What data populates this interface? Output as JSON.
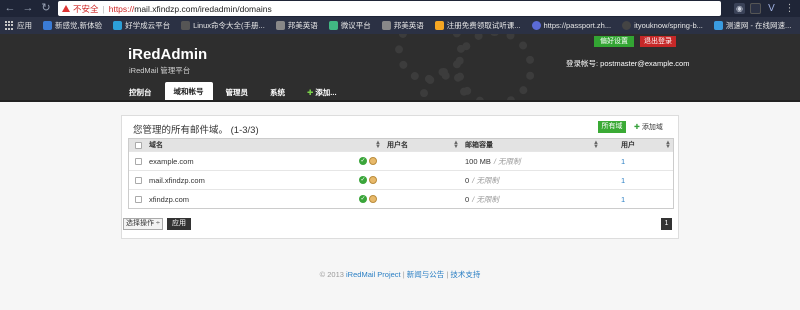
{
  "browser": {
    "insecure_label": "不安全",
    "url_https": "https://",
    "url_rest": "mail.xfindzp.com/iredadmin/domains",
    "bookmarks": [
      {
        "label": "应用",
        "color": "#c8c8c8"
      },
      {
        "label": "新感觉,新体验",
        "color": "#3a7bd5"
      },
      {
        "label": "好学成云平台",
        "color": "#2c9fd8"
      },
      {
        "label": "Linux命令大全(手册...",
        "color": "#555555"
      },
      {
        "label": "邦美英语",
        "color": "#888888"
      },
      {
        "label": "微议平台",
        "color": "#41b883"
      },
      {
        "label": "邦美英语",
        "color": "#888888"
      },
      {
        "label": "注册免费领取试听课...",
        "color": "#f5a623"
      },
      {
        "label": "https://passport.zh...",
        "color": "#5b6bd6"
      },
      {
        "label": "ityouknow/spring-b...",
        "color": "#444444"
      },
      {
        "label": "测速网 - 在线网速...",
        "color": "#3a9be0"
      }
    ]
  },
  "header": {
    "brand": "iRedAdmin",
    "subtitle": "iRedMail 管理平台",
    "pref_label": "偏好设置",
    "logout_label": "退出登录",
    "login_info": "登录帐号: postmaster@example.com",
    "nav": [
      {
        "label": "控制台",
        "active": false
      },
      {
        "label": "域和帐号",
        "active": true
      },
      {
        "label": "管理员",
        "active": false
      },
      {
        "label": "系统",
        "active": false
      },
      {
        "label": "添加...",
        "active": false
      }
    ]
  },
  "panel": {
    "title": "您管理的所有邮件域。 (1-3/3)",
    "all_domains_label": "所有域",
    "add_domain_label": "添加域",
    "columns": {
      "domain": "域名",
      "name": "用户名",
      "quota": "邮箱容量",
      "users": "用户"
    },
    "rows": [
      {
        "domain": "example.com",
        "quota": "100 MB",
        "quota_unl": "/ 无限制",
        "users": "1"
      },
      {
        "domain": "mail.xfindzp.com",
        "quota": "0",
        "quota_unl": "/ 无限制",
        "users": "1"
      },
      {
        "domain": "xfindzp.com",
        "quota": "0",
        "quota_unl": "/ 无限制",
        "users": "1"
      }
    ],
    "select_action": "选择操作 ÷",
    "apply_label": "应用",
    "page": "1"
  },
  "footer": {
    "copyright": "© 2013",
    "project": "iRedMail Project",
    "sep1": " | ",
    "news": "新闻与公告",
    "sep2": " | ",
    "support": "技术支持"
  }
}
